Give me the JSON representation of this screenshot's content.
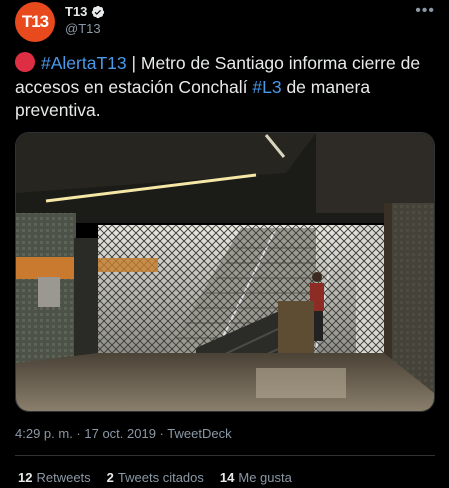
{
  "author": {
    "avatar_text": "T13",
    "display_name": "T13",
    "handle": "@T13",
    "verified": true
  },
  "menu_icon": "more-dots-icon",
  "tweet": {
    "emoji": "red-circle",
    "hashtag1": "#AlertaT13",
    "text1": " | Metro de Santiago informa cierre de accesos en estación Conchalí ",
    "hashtag2": "#L3",
    "text2": " de manera preventiva."
  },
  "media": {
    "description_icon": "metro-station-closed-gate-photo"
  },
  "meta": {
    "time": "4:29 p. m.",
    "sep1": " · ",
    "date": "17 oct. 2019",
    "sep2": " · ",
    "source": "TweetDeck"
  },
  "stats": {
    "retweets_count": "12",
    "retweets_label": "Retweets",
    "quotes_count": "2",
    "quotes_label": "Tweets citados",
    "likes_count": "14",
    "likes_label": "Me gusta"
  },
  "colors": {
    "background": "#000000",
    "accent": "#4a99e9",
    "brand": "#e8491d",
    "muted": "#8b98a5"
  }
}
